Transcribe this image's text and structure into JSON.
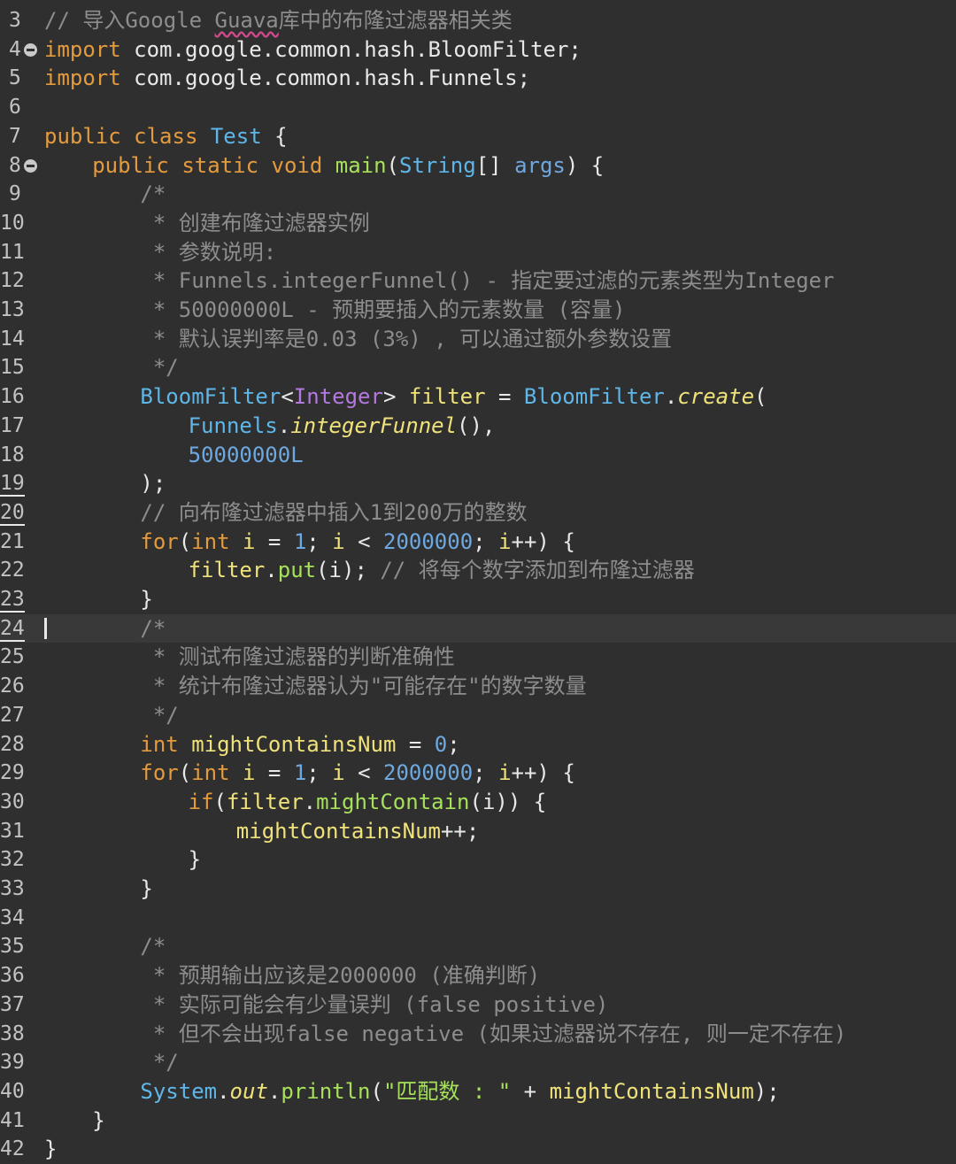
{
  "editor": {
    "line_numbers": [
      "3",
      "4",
      "5",
      "6",
      "7",
      "8",
      "9",
      "10",
      "11",
      "12",
      "13",
      "14",
      "15",
      "16",
      "17",
      "18",
      "19",
      "20",
      "21",
      "22",
      "23",
      "24",
      "25",
      "26",
      "27",
      "28",
      "29",
      "30",
      "31",
      "32",
      "33",
      "34",
      "35",
      "36",
      "37",
      "38",
      "39",
      "40",
      "41",
      "42"
    ],
    "current_line": "24",
    "lines": {
      "l3": {
        "comment": "// 导入Google ",
        "guava": "Guava",
        "rest": "库中的布隆过滤器相关类"
      },
      "l4": {
        "kw": "import",
        "path": " com.google.common.hash.BloomFilter;"
      },
      "l5": {
        "kw": "import",
        "path": " com.google.common.hash.Funnels;"
      },
      "l7": {
        "kw1": "public",
        "kw2": "class",
        "cls": "Test",
        "brace": " {"
      },
      "l8": {
        "kw1": "public",
        "kw2": "static",
        "kw3": "void",
        "fn": "main",
        "p1": "(",
        "type": "String",
        "p2": "[] ",
        "arg": "args",
        "p3": ") {"
      },
      "l9": {
        "c": "/*"
      },
      "l10": {
        "c": " * 创建布隆过滤器实例"
      },
      "l11": {
        "c": " * 参数说明:"
      },
      "l12": {
        "c": " * Funnels.integerFunnel() - 指定要过滤的元素类型为Integer"
      },
      "l13": {
        "c": " * 50000000L - 预期要插入的元素数量 (容量)"
      },
      "l14": {
        "c": " * 默认误判率是0.03 (3%) , 可以通过额外参数设置"
      },
      "l15": {
        "c": " */"
      },
      "l16": {
        "cls1": "BloomFilter",
        "lt": "<",
        "gen": "Integer",
        "gt": ">",
        "var": "filter",
        "eq": " = ",
        "cls2": "BloomFilter",
        "dot": ".",
        "fn": "create",
        "paren": "("
      },
      "l17": {
        "cls": "Funnels",
        "dot": ".",
        "fn": "integerFunnel",
        "rest": "(),"
      },
      "l18": {
        "num": "50000000L"
      },
      "l19": {
        "t": ");"
      },
      "l20": {
        "c": "// 向布隆过滤器中插入1到200万的整数"
      },
      "l21": {
        "kw": "for",
        "p": "(",
        "kw2": "int",
        "v1": "i",
        "eq": " = ",
        "n1": "1",
        "s1": "; ",
        "v2": "i",
        "lt": " < ",
        "n2": "2000000",
        "s2": "; ",
        "v3": "i",
        "rest": "++) {"
      },
      "l22": {
        "v": "filter",
        "dot": ".",
        "fn": "put",
        "args": "(i); ",
        "c": "// 将每个数字添加到布隆过滤器"
      },
      "l23": {
        "t": "}"
      },
      "l24": {
        "c": "/*"
      },
      "l25": {
        "c": " * 测试布隆过滤器的判断准确性"
      },
      "l26": {
        "c": " * 统计布隆过滤器认为\"可能存在\"的数字数量"
      },
      "l27": {
        "c": " */"
      },
      "l28": {
        "kw": "int",
        "v": "mightContainsNum",
        "eq": " = ",
        "n": "0",
        "semi": ";"
      },
      "l29": {
        "kw": "for",
        "p": "(",
        "kw2": "int",
        "v1": "i",
        "eq": " = ",
        "n1": "1",
        "s1": "; ",
        "v2": "i",
        "lt": " < ",
        "n2": "2000000",
        "s2": "; ",
        "v3": "i",
        "rest": "++) {"
      },
      "l30": {
        "kw": "if",
        "p": "(",
        "v": "filter",
        "dot": ".",
        "fn": "mightContain",
        "rest": "(i)) {"
      },
      "l31": {
        "v": "mightContainsNum",
        "rest": "++;"
      },
      "l32": {
        "t": "}"
      },
      "l33": {
        "t": "}"
      },
      "l35": {
        "c": "/*"
      },
      "l36": {
        "c": " * 预期输出应该是2000000 (准确判断)"
      },
      "l37": {
        "c": " * 实际可能会有少量误判 (false positive)"
      },
      "l38": {
        "c": " * 但不会出现false negative (如果过滤器说不存在, 则一定不存在)"
      },
      "l39": {
        "c": " */"
      },
      "l40": {
        "cls": "System",
        "dot1": ".",
        "field": "out",
        "dot2": ".",
        "fn": "println",
        "p": "(",
        "str": "\"匹配数 : \"",
        "plus": " + ",
        "v": "mightContainsNum",
        "rest": ");"
      },
      "l41": {
        "t": "}"
      },
      "l42": {
        "t": "}"
      }
    }
  },
  "colors": {
    "background": "#2f2f2f",
    "current_line": "#393939",
    "keyword": "#e49b3e",
    "class": "#5fb6e8",
    "generic": "#b479e0",
    "variable": "#f0e27a",
    "method": "#a7e05a",
    "number": "#6ea8e0",
    "comment": "#8d8d8d"
  }
}
